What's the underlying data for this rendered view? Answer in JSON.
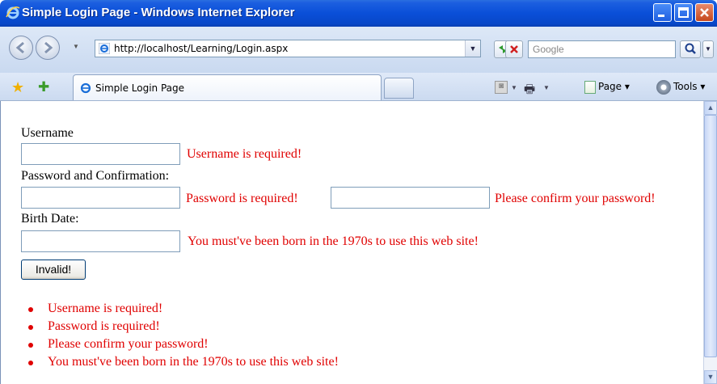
{
  "window": {
    "title": "Simple Login Page - Windows Internet Explorer"
  },
  "address_bar": {
    "url": "http://localhost/Learning/Login.aspx",
    "search_placeholder": "Google"
  },
  "tabs": [
    {
      "label": "Simple Login Page"
    }
  ],
  "command_bar": {
    "page_label": "Page",
    "tools_label": "Tools"
  },
  "form": {
    "username_label": "Username",
    "username_value": "",
    "username_error": "Username is required!",
    "password_label": "Password and Confirmation:",
    "password_value": "",
    "password_error": "Password is required!",
    "confirm_value": "",
    "confirm_error": "Please confirm your password!",
    "birthdate_label": "Birth Date:",
    "birthdate_value": "",
    "birthdate_error": "You must've been born in the 1970s to use this web site!",
    "submit_label": "Invalid!"
  },
  "validation_summary": [
    "Username is required!",
    "Password is required!",
    "Please confirm your password!",
    "You must've been born in the 1970s to use this web site!"
  ],
  "colors": {
    "error": "#e00000",
    "titlebar": "#0a4fd8"
  },
  "icons": [
    "ie-icon",
    "back-arrow-icon",
    "forward-arrow-icon",
    "refresh-icon",
    "stop-icon",
    "search-icon",
    "favorites-star-icon",
    "add-favorites-icon",
    "feeds-icon",
    "print-icon",
    "page-icon",
    "tools-gear-icon"
  ]
}
